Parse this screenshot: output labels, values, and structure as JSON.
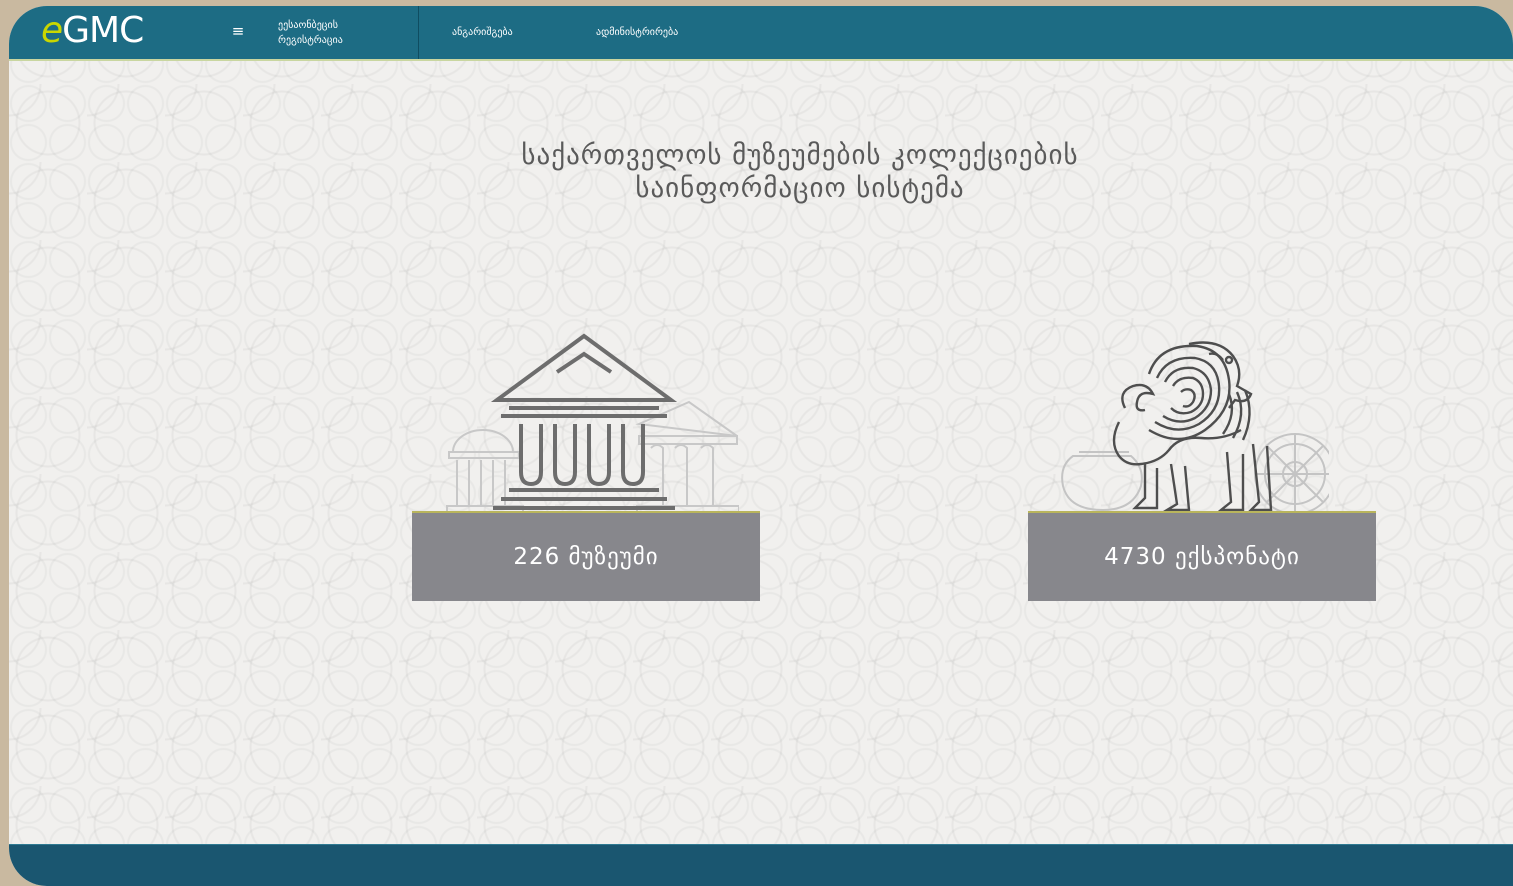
{
  "header": {
    "logo_prefix": "e",
    "logo_rest": "GMC",
    "menu_icon": "≡",
    "menu_label_line1": "ეესაონბეცის",
    "menu_label_line2": "რეგისტრაცია",
    "nav": [
      {
        "label": "ანგარიშგება"
      },
      {
        "label": "ადმინისტრირება"
      }
    ]
  },
  "main": {
    "title_line1": "საქართველოს მუზეუმების კოლექციების",
    "title_line2": "საინფორმაციო სისტემა"
  },
  "stats": [
    {
      "label": "226 მუზეუმი",
      "icon": "museum-building-illustration"
    },
    {
      "label": "4730 ექსპონატი",
      "icon": "griffin-artifact-illustration"
    }
  ],
  "colors": {
    "nav_bg": "#1d6c84",
    "footer_bg": "#1a5670",
    "card_bg": "#87878c",
    "logo_accent": "#c9d600",
    "page_bg": "#f1f0ee"
  }
}
